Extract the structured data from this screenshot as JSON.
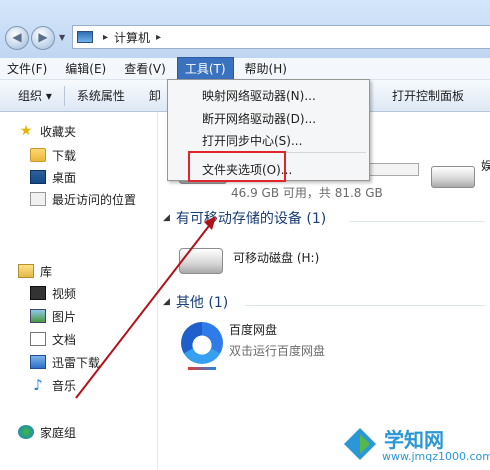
{
  "address": {
    "location": "计算机",
    "separator": "▸"
  },
  "menu": [
    "文件(F)",
    "编辑(E)",
    "查看(V)",
    "工具(T)",
    "帮助(H)"
  ],
  "toolbar": {
    "organize": "组织 ▾",
    "system_props": "系统属性",
    "partial": "卸",
    "control_panel": "打开控制面板"
  },
  "sidebar": {
    "favorites": "收藏夹",
    "favorites_items": [
      "下载",
      "桌面",
      "最近访问的位置"
    ],
    "libraries": "库",
    "library_items": [
      "视频",
      "图片",
      "文档",
      "迅雷下载",
      "音乐"
    ],
    "homegroup": "家庭组"
  },
  "tools_menu": {
    "items": [
      "映射网络驱动器(N)...",
      "断开网络驱动器(D)...",
      "打开同步中心(S)...",
      "文件夹选项(O)..."
    ]
  },
  "content": {
    "drive_size": "46.9 GB 可用，共 81.8 GB",
    "right_partial": "娱",
    "section_removable": "有可移动存储的设备 (1)",
    "removable_name": "可移动磁盘 (H:)",
    "section_other": "其他 (1)",
    "baidu_name": "百度网盘",
    "baidu_desc": "双击运行百度网盘"
  },
  "watermark": {
    "title": "学知网",
    "url": "www.jmqz1000.com"
  },
  "colors": {
    "menu_active": "#3a72c0",
    "highlight_box": "#e0262b",
    "arrow": "#b0121a",
    "section_text": "#1a3e78"
  }
}
